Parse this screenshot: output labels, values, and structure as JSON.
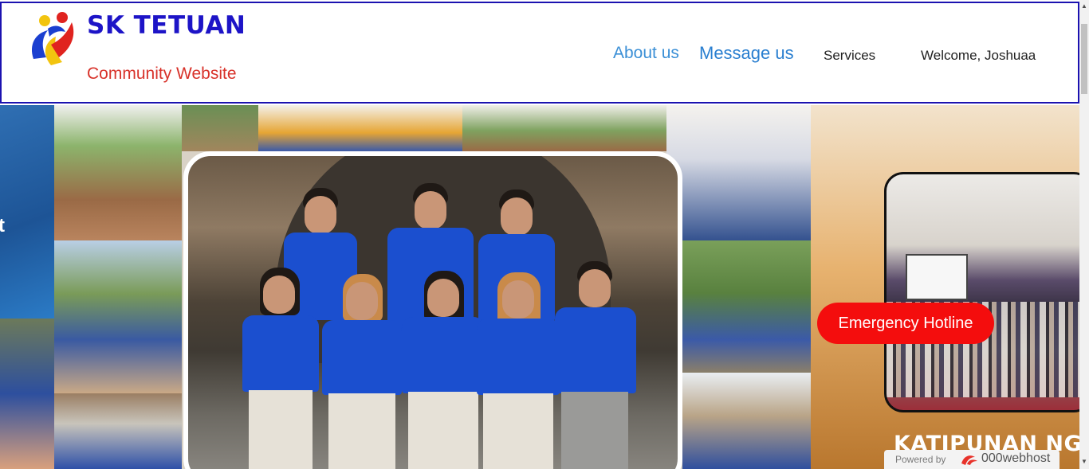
{
  "header": {
    "brand_title": "SK TETUAN",
    "brand_subtitle": "Community Website",
    "nav": {
      "about": "About us",
      "message": "Message us",
      "services": "Services",
      "welcome": "Welcome, Joshuaa"
    }
  },
  "hero": {
    "left_fragment_text": "t",
    "banner_text": "KATIPUNAN NG K"
  },
  "hotline": {
    "label": "Emergency Hotline"
  },
  "powered": {
    "label": "Powered by",
    "brand": "000webhost"
  },
  "colors": {
    "brand_blue": "#1d14c7",
    "brand_red": "#d8322a",
    "nav_link_blue": "#3a8fd6",
    "hotline_red": "#f40d0d",
    "header_border": "#1b12b0"
  },
  "icons": {
    "logo": "sk-logo-icon",
    "scroll_up": "chevron-up-icon",
    "scroll_down": "chevron-down-icon",
    "host_logo": "webhost-logo-icon"
  }
}
